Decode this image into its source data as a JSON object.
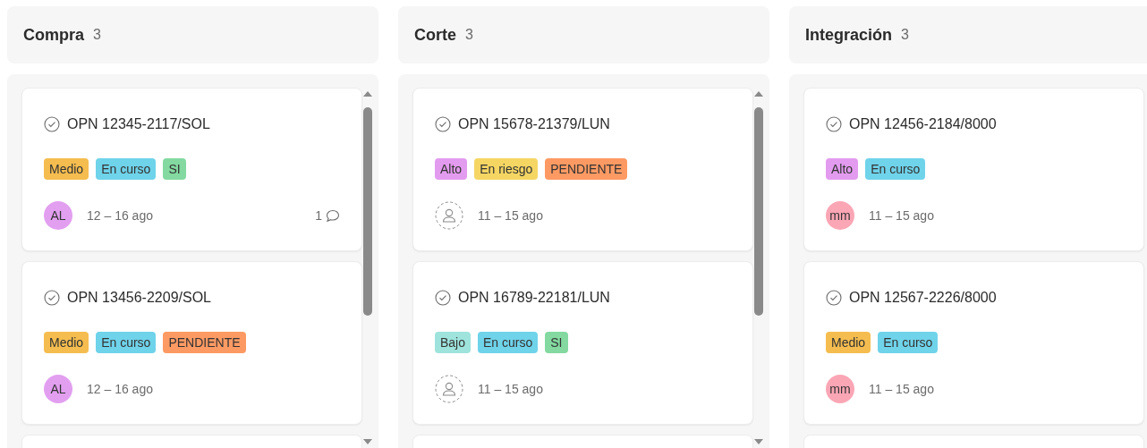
{
  "columns": [
    {
      "title": "Compra",
      "count": "3",
      "scrollbar": true,
      "cards": [
        {
          "title": "OPN 12345-2117/SOL",
          "tags": [
            {
              "label": "Medio",
              "color": "#f5bd4f"
            },
            {
              "label": "En curso",
              "color": "#6fd3ea"
            },
            {
              "label": "SI",
              "color": "#83d9a0"
            }
          ],
          "assignee": {
            "kind": "avatar",
            "initials": "AL",
            "color": "#e29ff0"
          },
          "dates": "12 – 16 ago",
          "comments": "1"
        },
        {
          "title": "OPN 13456-2209/SOL",
          "tags": [
            {
              "label": "Medio",
              "color": "#f5bd4f"
            },
            {
              "label": "En curso",
              "color": "#6fd3ea"
            },
            {
              "label": "PENDIENTE",
              "color": "#fd9a63"
            }
          ],
          "assignee": {
            "kind": "avatar",
            "initials": "AL",
            "color": "#e29ff0"
          },
          "dates": "12 – 16 ago"
        }
      ]
    },
    {
      "title": "Corte",
      "count": "3",
      "scrollbar": true,
      "cards": [
        {
          "title": "OPN 15678-21379/LUN",
          "tags": [
            {
              "label": "Alto",
              "color": "#e39bef"
            },
            {
              "label": "En riesgo",
              "color": "#f5d663"
            },
            {
              "label": "PENDIENTE",
              "color": "#fd9a63"
            }
          ],
          "assignee": {
            "kind": "empty"
          },
          "dates": "11 – 15 ago"
        },
        {
          "title": "OPN 16789-22181/LUN",
          "tags": [
            {
              "label": "Bajo",
              "color": "#9ee3dc"
            },
            {
              "label": "En curso",
              "color": "#6fd3ea"
            },
            {
              "label": "SI",
              "color": "#83d9a0"
            }
          ],
          "assignee": {
            "kind": "empty"
          },
          "dates": "11 – 15 ago"
        }
      ]
    },
    {
      "title": "Integración",
      "count": "3",
      "scrollbar": false,
      "cards": [
        {
          "title": "OPN 12456-2184/8000",
          "tags": [
            {
              "label": "Alto",
              "color": "#e39bef"
            },
            {
              "label": "En curso",
              "color": "#6fd3ea"
            }
          ],
          "assignee": {
            "kind": "avatar",
            "initials": "mm",
            "color": "#fba6b5"
          },
          "dates": "11 – 15 ago"
        },
        {
          "title": "OPN 12567-2226/8000",
          "tags": [
            {
              "label": "Medio",
              "color": "#f5bd4f"
            },
            {
              "label": "En curso",
              "color": "#6fd3ea"
            }
          ],
          "assignee": {
            "kind": "avatar",
            "initials": "mm",
            "color": "#fba6b5"
          },
          "dates": "11 – 15 ago"
        }
      ]
    }
  ]
}
